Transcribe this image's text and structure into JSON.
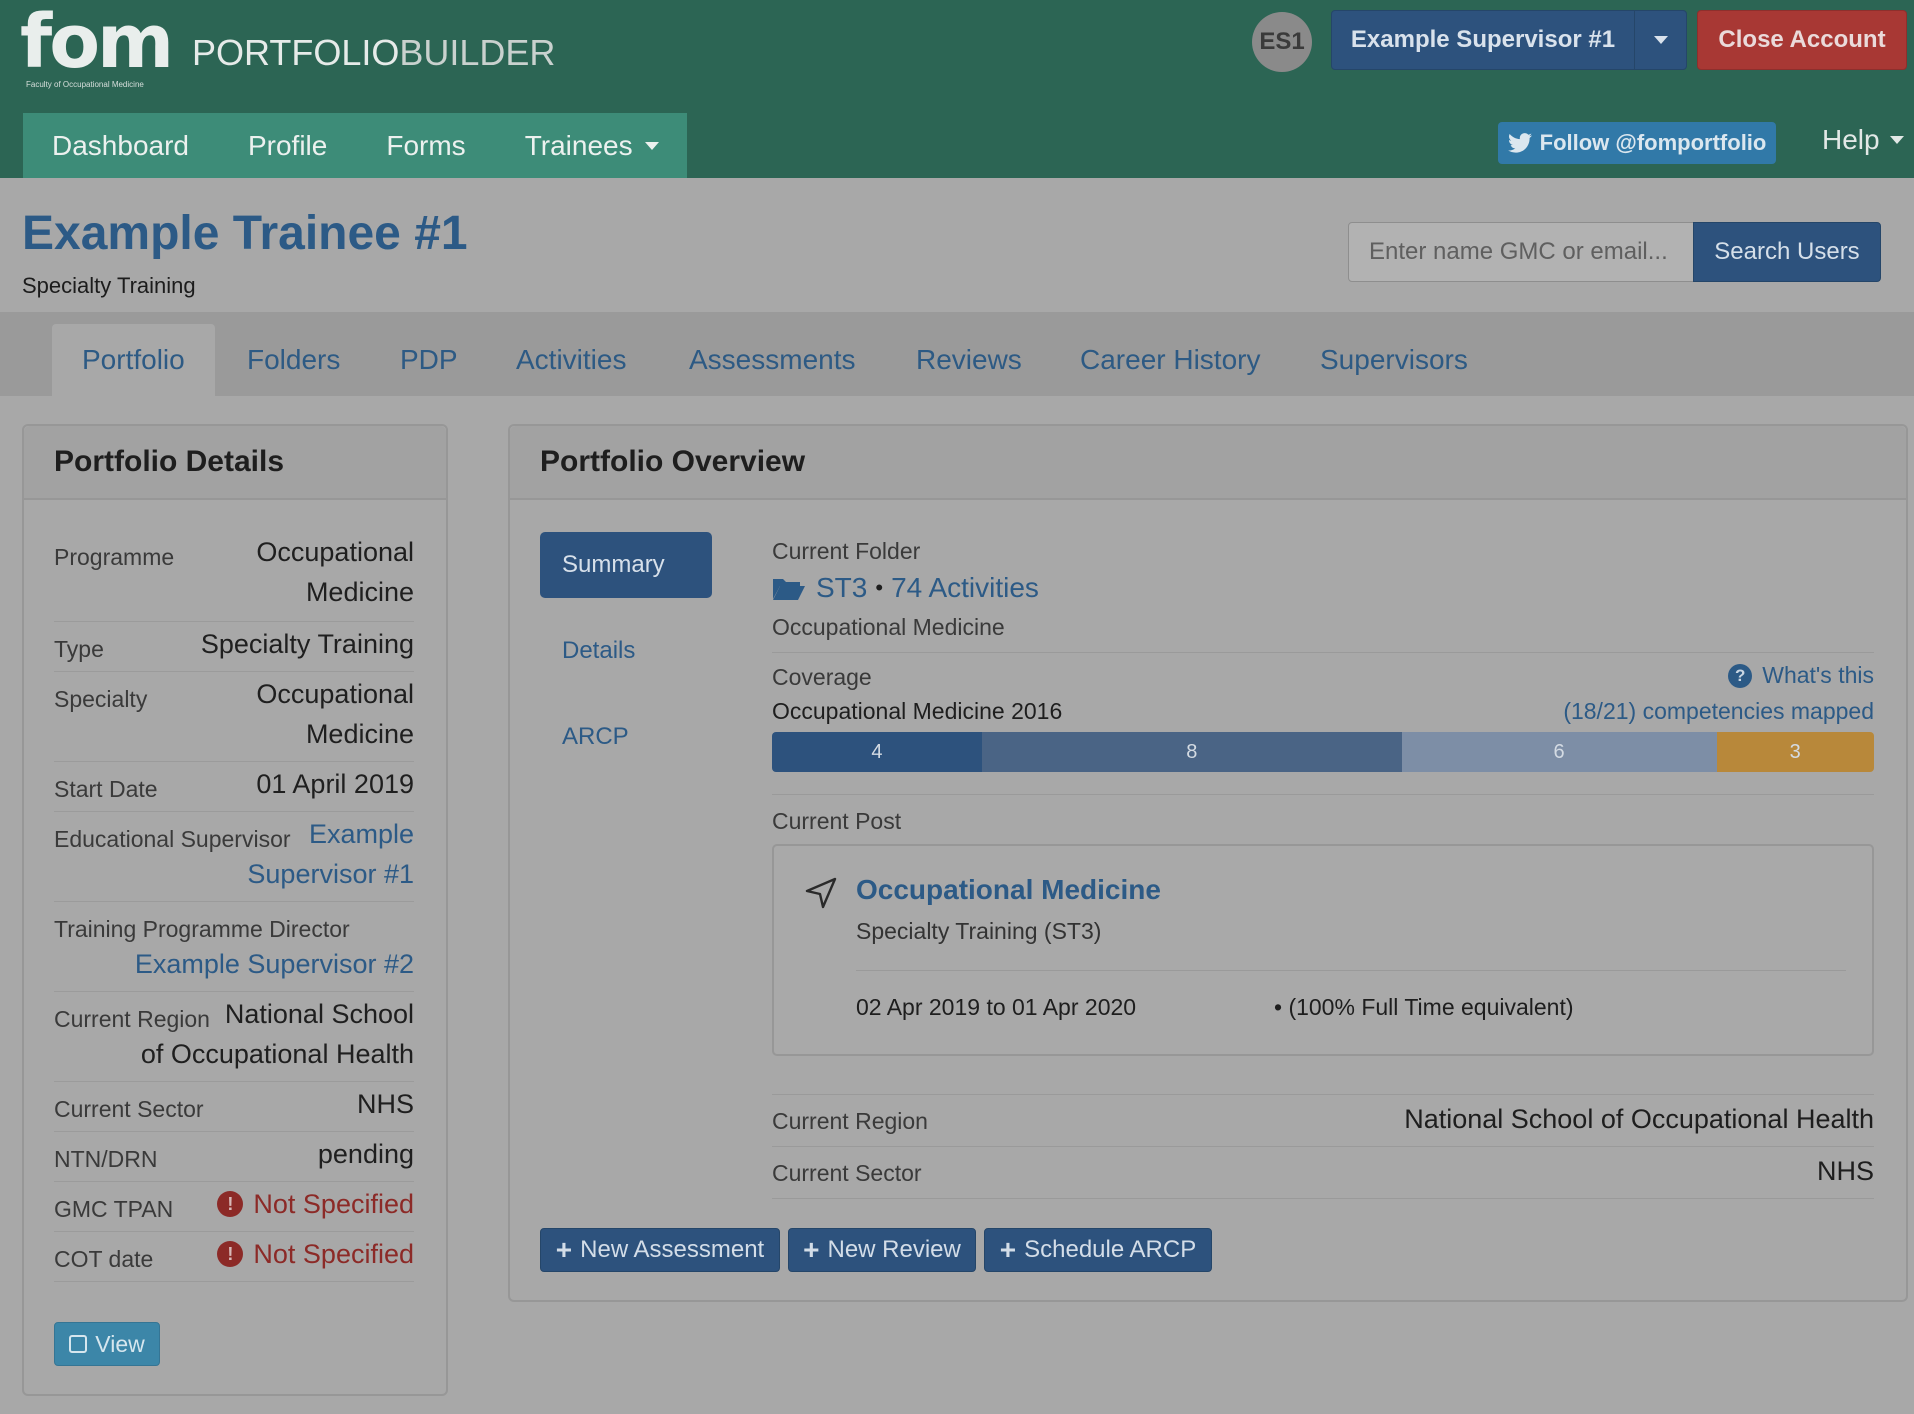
{
  "header": {
    "logo_text": "fom",
    "logo_subtitle": "Faculty of Occupational Medicine",
    "app_title_a": "PORTFOLIO",
    "app_title_b": "BUILDER",
    "avatar_initials": "ES1",
    "user_button": "Example Supervisor #1",
    "close_account": "Close Account",
    "follow": "Follow @fomportfolio",
    "help": "Help",
    "nav": [
      {
        "label": "Dashboard"
      },
      {
        "label": "Profile"
      },
      {
        "label": "Forms"
      },
      {
        "label": "Trainees"
      }
    ]
  },
  "trainee": {
    "name": "Example Trainee #1",
    "type": "Specialty Training"
  },
  "search": {
    "placeholder": "Enter name GMC or email...",
    "button": "Search Users"
  },
  "tabs": [
    {
      "label": "Portfolio"
    },
    {
      "label": "Folders"
    },
    {
      "label": "PDP"
    },
    {
      "label": "Activities"
    },
    {
      "label": "Assessments"
    },
    {
      "label": "Reviews"
    },
    {
      "label": "Career History"
    },
    {
      "label": "Supervisors"
    }
  ],
  "details": {
    "title": "Portfolio Details",
    "rows": [
      {
        "label": "Programme",
        "value_line1": "Occupational",
        "value_line2": "Medicine"
      },
      {
        "label": "Type",
        "value_line1": "Specialty Training"
      },
      {
        "label": "Specialty",
        "value_line1": "Occupational",
        "value_line2": "Medicine"
      },
      {
        "label": "Start Date",
        "value_line1": "01 April 2019"
      },
      {
        "label": "Educational Supervisor",
        "value_line1": "Example",
        "value_line2": "Supervisor #1"
      },
      {
        "label": "Training Programme Director",
        "value_line1": "Example Supervisor #2"
      },
      {
        "label": "Current Region",
        "value_line1": "National School",
        "value_line2": "of Occupational Health"
      },
      {
        "label": "Current Sector",
        "value_line1": "NHS"
      },
      {
        "label": "NTN/DRN",
        "value_line1": "pending"
      },
      {
        "label": "GMC TPAN",
        "value_line1": "Not Specified"
      },
      {
        "label": "COT date",
        "value_line1": "Not Specified"
      }
    ],
    "view_button": "View"
  },
  "overview": {
    "title": "Portfolio Overview",
    "pills": [
      {
        "label": "Summary"
      },
      {
        "label": "Details"
      },
      {
        "label": "ARCP"
      }
    ],
    "current_folder_label": "Current Folder",
    "folder_name": "ST3",
    "folder_sep": "•",
    "folder_activities": "74 Activities",
    "folder_programme": "Occupational Medicine",
    "coverage_label": "Coverage",
    "whats_this": "What's this",
    "coverage_curriculum": "Occupational Medicine 2016",
    "competencies_mapped": "(18/21) competencies mapped",
    "coverage_segments": [
      {
        "value": 4,
        "color": "#2d527d"
      },
      {
        "value": 8,
        "color": "#4a6485"
      },
      {
        "value": 6,
        "color": "#7d8ea6"
      },
      {
        "value": 3,
        "color": "#b8883a"
      }
    ],
    "current_post_label": "Current Post",
    "post_title": "Occupational Medicine",
    "post_subtitle": "Specialty Training (ST3)",
    "post_dates": "02 Apr 2019 to 01 Apr 2020",
    "post_fte": "• (100% Full Time equivalent)",
    "region_label": "Current Region",
    "region_value": "National School of Occupational Health",
    "sector_label": "Current Sector",
    "sector_value": "NHS",
    "actions": [
      {
        "label": "New Assessment"
      },
      {
        "label": "New Review"
      },
      {
        "label": "Schedule ARCP"
      }
    ]
  }
}
